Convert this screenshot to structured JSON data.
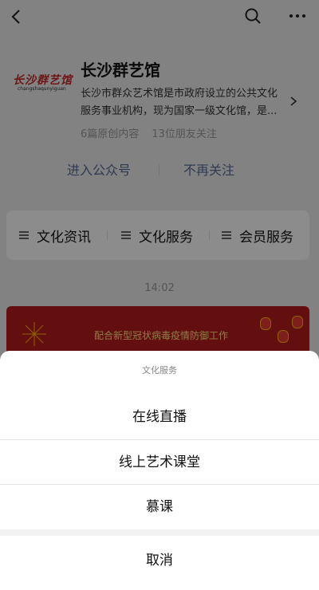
{
  "account": {
    "logo_text": "长沙群艺馆",
    "logo_subtext": "changshaqunyiguan",
    "name": "长沙群艺馆",
    "description": "长沙市群众艺术馆是市政府设立的公共文化服务事业机构，现为国家一级文化馆，是...",
    "original_count": "6篇原创内容",
    "friends_following": "13位朋友关注"
  },
  "actions": {
    "enter": "进入公众号",
    "unfollow": "不再关注"
  },
  "menu": {
    "items": [
      {
        "label": "文化资讯"
      },
      {
        "label": "文化服务"
      },
      {
        "label": "会员服务"
      }
    ]
  },
  "timestamp": "14:02",
  "banner": {
    "text": "配合新型冠状病毒疫情防御工作"
  },
  "action_sheet": {
    "title": "文化服务",
    "options": [
      {
        "label": "在线直播"
      },
      {
        "label": "线上艺术课堂"
      },
      {
        "label": "慕课"
      }
    ],
    "cancel": "取消"
  },
  "colors": {
    "link": "#576b95",
    "banner_red": "#b71c1c",
    "logo_red": "#c62828"
  }
}
